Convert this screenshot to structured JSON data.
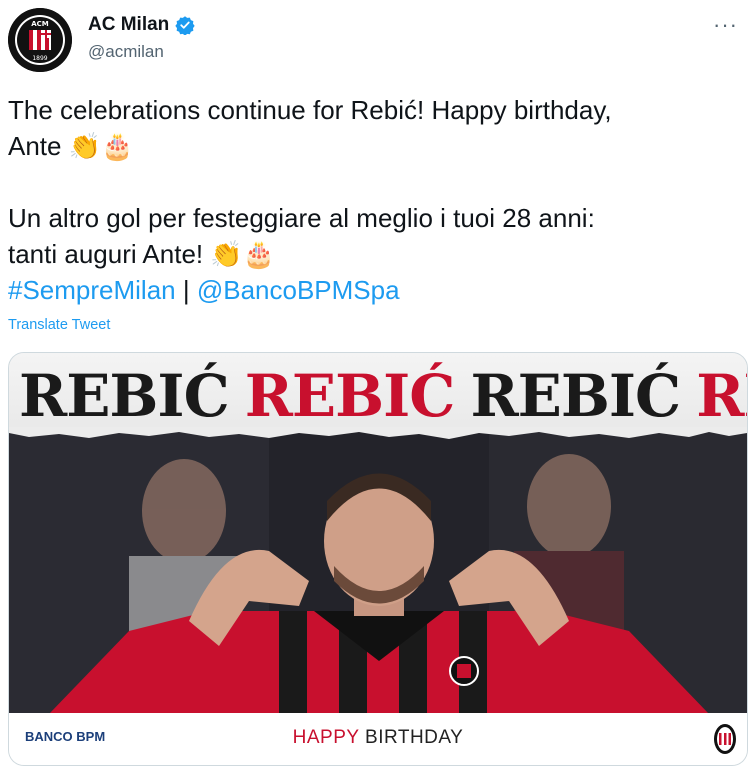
{
  "account": {
    "display_name": "AC Milan",
    "handle": "@acmilan",
    "verified": true,
    "avatar_icon": "ac-milan-crest-icon"
  },
  "more_label": "···",
  "tweet": {
    "line1": "The celebrations continue for Rebić! Happy birthday,",
    "line2": "Ante 👏🎂",
    "line3": "Un altro gol per festeggiare al meglio i tuoi 28 anni:",
    "line4": "tanti auguri Ante! 👏🎂",
    "hashtag": "#SempreMilan",
    "separator": " | ",
    "mention": "@BancoBPMSpa"
  },
  "translate_label": "Translate Tweet",
  "media": {
    "banner_words": [
      "REBIĆ",
      "REBIĆ",
      "REBIĆ",
      "REBIĆ"
    ],
    "sponsor": "BANCO BPM",
    "happy": "HAPPY",
    "birthday": "BIRTHDAY"
  },
  "colors": {
    "link": "#1d9bf0",
    "milan_red": "#c8102e",
    "text": "#0f1419",
    "muted": "#536471"
  }
}
